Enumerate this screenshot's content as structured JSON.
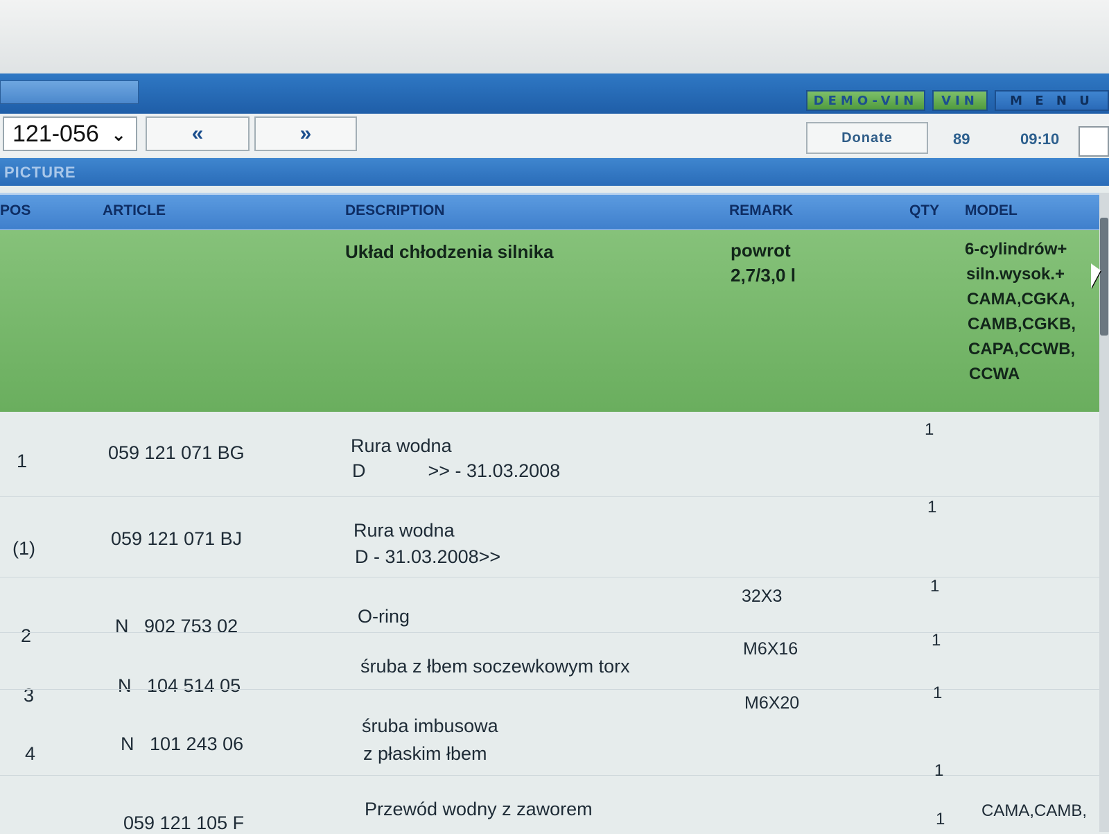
{
  "titlebar": {
    "demo_vin": "DEMO-VIN",
    "vin": "VIN",
    "menu": "M E N U"
  },
  "toolbar": {
    "group_select": "121-056",
    "prev_label": "«",
    "next_label": "»",
    "donate_label": "Donate",
    "counter": "89",
    "time": "09:10"
  },
  "section_label": "PICTURE",
  "columns": {
    "pos": "POS",
    "article": "ARTICLE",
    "description": "DESCRIPTION",
    "remark": "REMARK",
    "qty": "QTY",
    "model": "MODEL"
  },
  "group_row": {
    "description": "Układ chłodzenia silnika",
    "remark_lines": [
      "powrot",
      "2,7/3,0 l"
    ],
    "model_lines": [
      "6-cylindrów+",
      "siln.wysok.+",
      "CAMA,CGKA,",
      "CAMB,CGKB,",
      "CAPA,CCWB,",
      "CCWA"
    ]
  },
  "rows": [
    {
      "pos": "1",
      "article": "059 121 071 BG",
      "desc1": "Rura wodna",
      "desc2": "D            >> - 31.03.2008",
      "remark": "",
      "qty": "1",
      "model": ""
    },
    {
      "pos": "(1)",
      "article": "059 121 071 BJ",
      "desc1": "Rura wodna",
      "desc2": "D - 31.03.2008>>",
      "remark": "",
      "qty": "1",
      "model": ""
    },
    {
      "pos": "2",
      "article": "N   902 753 02",
      "desc1": "O-ring",
      "desc2": "",
      "remark": "32X3",
      "qty": "1",
      "model": ""
    },
    {
      "pos": "3",
      "article": "N   104 514 05",
      "desc1": "śruba z łbem soczewkowym torx",
      "desc2": "",
      "remark": "M6X16",
      "qty": "1",
      "model": ""
    },
    {
      "pos": "4",
      "article": "N   101 243 06",
      "desc1": "śruba imbusowa",
      "desc2": "z płaskim łbem",
      "remark": "M6X20",
      "qty": "1",
      "model": ""
    },
    {
      "pos": "",
      "article": "059 121 105 F",
      "desc1": "Przewód wodny z zaworem",
      "desc2": "",
      "remark": "",
      "qty": "1",
      "model": "CAMA,CAMB,"
    }
  ],
  "extra_qty": "1"
}
